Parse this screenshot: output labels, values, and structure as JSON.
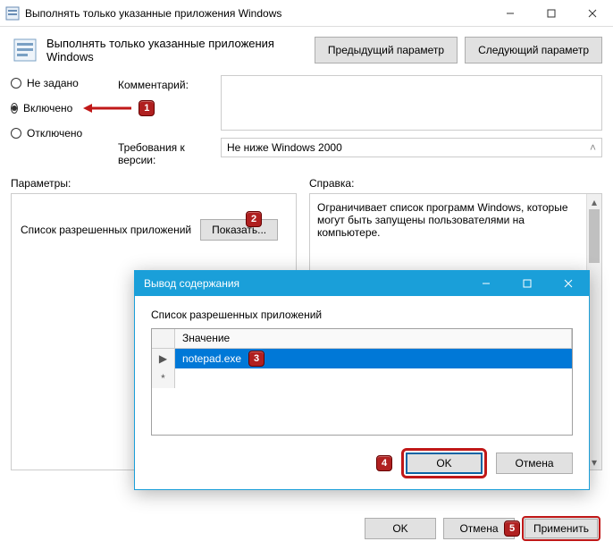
{
  "window": {
    "title": "Выполнять только указанные приложения Windows",
    "header": "Выполнять только указанные приложения Windows",
    "btn_prev": "Предыдущий параметр",
    "btn_next": "Следующий параметр"
  },
  "radios": {
    "not_configured": "Не задано",
    "enabled": "Включено",
    "disabled": "Отключено",
    "selected": "enabled"
  },
  "fields": {
    "comment_label": "Комментарий:",
    "requirements_label": "Требования к версии:",
    "requirements_value": "Не ниже Windows 2000"
  },
  "sections": {
    "params": "Параметры:",
    "help": "Справка:"
  },
  "params": {
    "allowed_label": "Список разрешенных приложений",
    "show_btn": "Показать..."
  },
  "help": {
    "text": "Ограничивает список программ Windows, которые могут быть запущены пользователями на компьютере."
  },
  "footer": {
    "ok": "OK",
    "cancel": "Отмена",
    "apply": "Применить"
  },
  "dialog": {
    "title": "Вывод содержания",
    "subtitle": "Список разрешенных приложений",
    "col_value": "Значение",
    "rows": [
      "notepad.exe"
    ],
    "ok": "OK",
    "cancel": "Отмена"
  },
  "badges": {
    "b1": "1",
    "b2": "2",
    "b3": "3",
    "b4": "4",
    "b5": "5"
  }
}
